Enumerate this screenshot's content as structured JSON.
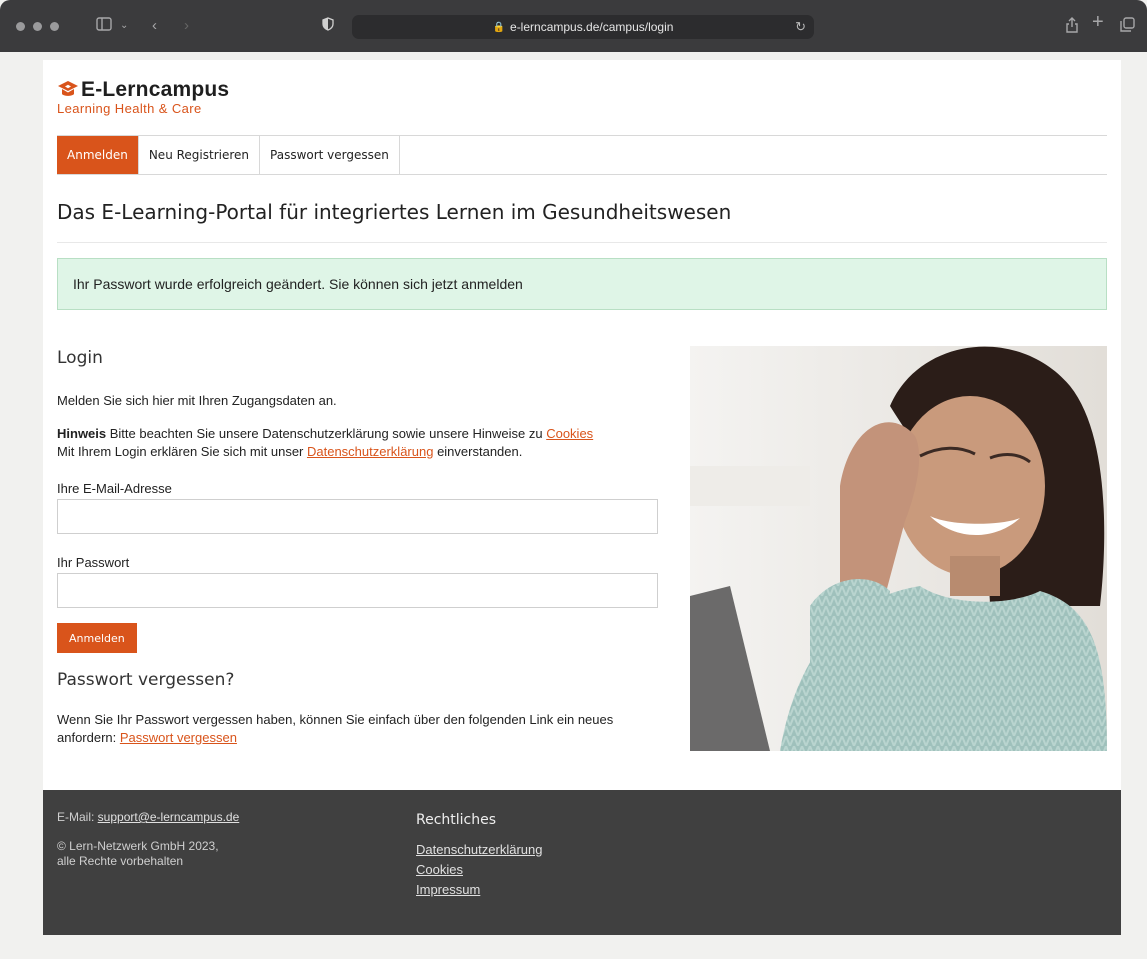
{
  "browser": {
    "url": "e-lerncampus.de/campus/login",
    "icons": [
      "sidebar-icon",
      "chevron-down-icon",
      "back-icon",
      "forward-icon",
      "shield-icon",
      "lock-icon",
      "reload-icon",
      "share-icon",
      "new-tab-icon",
      "tabs-icon"
    ]
  },
  "logo": {
    "name": "E-Lerncampus",
    "tagline": "Learning Health & Care"
  },
  "nav": {
    "items": [
      {
        "label": "Anmelden"
      },
      {
        "label": "Neu Registrieren"
      },
      {
        "label": "Passwort vergessen"
      }
    ]
  },
  "headline": "Das E-Learning-Portal für integriertes Lernen im Gesundheitswesen",
  "alert": "Ihr Passwort wurde erfolgreich geändert. Sie können sich jetzt anmelden",
  "login": {
    "title": "Login",
    "intro": "Melden Sie sich hier mit Ihren Zugangsdaten an.",
    "hint_label": "Hinweis",
    "hint_text": " Bitte beachten Sie unsere Datenschutzerklärung sowie unsere Hinweise zu ",
    "hint_link": "Cookies",
    "consent_text": "Mit Ihrem Login erklären Sie sich mit unser ",
    "consent_link": "Datenschutzerklärung",
    "consent_end": " einverstanden.",
    "email_label": "Ihre E-Mail-Adresse",
    "email_value": "",
    "password_label": "Ihr Passwort",
    "password_value": "",
    "submit": "Anmelden"
  },
  "forgot": {
    "title": "Passwort vergessen?",
    "text1": "Wenn Sie Ihr Passwort vergessen haben, können Sie einfach über den folgenden Link ein neues",
    "text2": "anfordern: ",
    "link": "Passwort vergessen"
  },
  "footer": {
    "email_label": "E-Mail: ",
    "email": "support@e-lerncampus.de",
    "copyright1": "© Lern-Netzwerk GmbH 2023,",
    "copyright2": "alle Rechte vorbehalten",
    "legal_title": "Rechtliches",
    "links": [
      "Datenschutzerklärung",
      "Cookies",
      "Impressum"
    ]
  },
  "colors": {
    "accent": "#d9541b",
    "alert_bg": "#dff5e7",
    "footer_bg": "#404040"
  }
}
